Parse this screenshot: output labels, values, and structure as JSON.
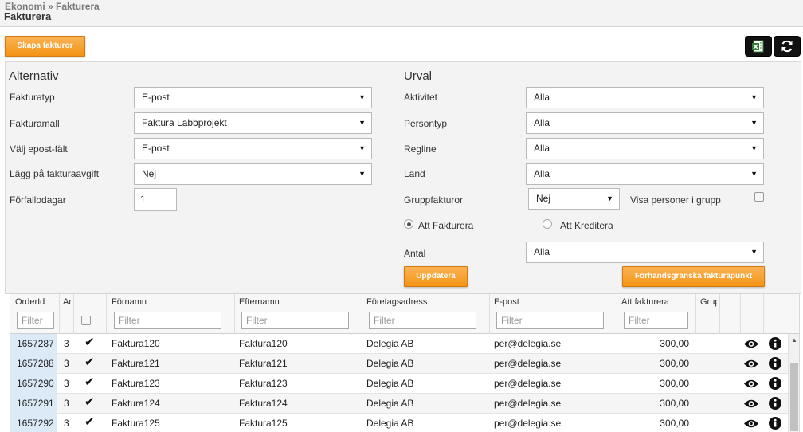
{
  "header": {
    "breadcrumb": "Ekonomi » Fakturera",
    "title": "Fakturera"
  },
  "toolbar": {
    "create_label": "Skapa fakturor",
    "excel_icon": "excel-icon",
    "refresh_icon": "refresh-icon"
  },
  "alternativ": {
    "title": "Alternativ",
    "fakturatyp_label": "Fakturatyp",
    "fakturatyp_value": "E-post",
    "fakturamall_label": "Fakturamall",
    "fakturamall_value": "Faktura Labbprojekt",
    "epost_label": "Välj epost-fält",
    "epost_value": "E-post",
    "avgift_label": "Lägg på fakturaavgift",
    "avgift_value": "Nej",
    "forfallo_label": "Förfallodagar",
    "forfallo_value": "1"
  },
  "urval": {
    "title": "Urval",
    "aktivitet_label": "Aktivitet",
    "aktivitet_value": "Alla",
    "persontyp_label": "Persontyp",
    "persontyp_value": "Alla",
    "regline_label": "Regline",
    "regline_value": "Alla",
    "land_label": "Land",
    "land_value": "Alla",
    "grupp_label": "Gruppfakturor",
    "grupp_value": "Nej",
    "visa_label": "Visa personer i grupp",
    "radio_fakturera": "Att Fakturera",
    "radio_kreditera": "Att Kreditera",
    "antal_label": "Antal",
    "antal_value": "Alla",
    "update_label": "Uppdatera",
    "preview_label": "Förhandsgranska fakturapunkt"
  },
  "grid": {
    "columns": {
      "orderid": "OrderId",
      "ar": "Ar",
      "fornamn": "Förnamn",
      "efternamn": "Efternamn",
      "foretag": "Företagsadress",
      "epost": "E-post",
      "att_fakturera": "Att fakturera",
      "grupp": "Grup"
    },
    "filter_placeholder": "Filter",
    "rows": [
      {
        "id": "1657287",
        "ar": "3",
        "fornamn": "Faktura120",
        "efternamn": "Faktura120",
        "foretag": "Delegia AB",
        "epost": "per@delegia.se",
        "belopp": "300,00"
      },
      {
        "id": "1657288",
        "ar": "3",
        "fornamn": "Faktura121",
        "efternamn": "Faktura121",
        "foretag": "Delegia AB",
        "epost": "per@delegia.se",
        "belopp": "300,00"
      },
      {
        "id": "1657290",
        "ar": "3",
        "fornamn": "Faktura123",
        "efternamn": "Faktura123",
        "foretag": "Delegia AB",
        "epost": "per@delegia.se",
        "belopp": "300,00"
      },
      {
        "id": "1657291",
        "ar": "3",
        "fornamn": "Faktura124",
        "efternamn": "Faktura124",
        "foretag": "Delegia AB",
        "epost": "per@delegia.se",
        "belopp": "300,00"
      },
      {
        "id": "1657292",
        "ar": "3",
        "fornamn": "Faktura125",
        "efternamn": "Faktura125",
        "foretag": "Delegia AB",
        "epost": "per@delegia.se",
        "belopp": "300,00"
      }
    ]
  }
}
